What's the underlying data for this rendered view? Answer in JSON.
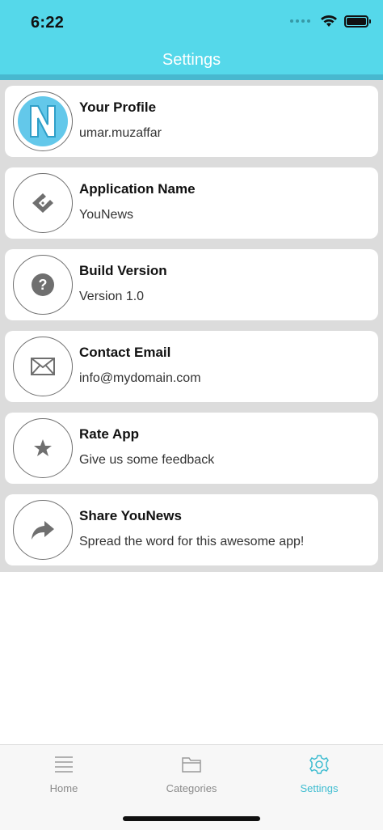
{
  "status_bar": {
    "time": "6:22"
  },
  "nav": {
    "title": "Settings"
  },
  "settings_items": [
    {
      "title": "Your Profile",
      "subtitle": "umar.muzaffar",
      "icon": "profile-logo-icon"
    },
    {
      "title": "Application Name",
      "subtitle": "YouNews",
      "icon": "app-name-icon"
    },
    {
      "title": "Build Version",
      "subtitle": "Version 1.0",
      "icon": "question-icon"
    },
    {
      "title": "Contact Email",
      "subtitle": "info@mydomain.com",
      "icon": "envelope-icon"
    },
    {
      "title": "Rate App",
      "subtitle": "Give us some feedback",
      "icon": "star-icon"
    },
    {
      "title": "Share YouNews",
      "subtitle": "Spread the word for this awesome app!",
      "icon": "share-icon"
    }
  ],
  "tabs": [
    {
      "label": "Home",
      "icon": "menu-lines-icon",
      "active": false
    },
    {
      "label": "Categories",
      "icon": "folder-icon",
      "active": false
    },
    {
      "label": "Settings",
      "icon": "gear-icon",
      "active": true
    }
  ],
  "colors": {
    "header": "#55d8ea",
    "accent": "#3dbcd0",
    "list_background": "#dcdcdc"
  }
}
